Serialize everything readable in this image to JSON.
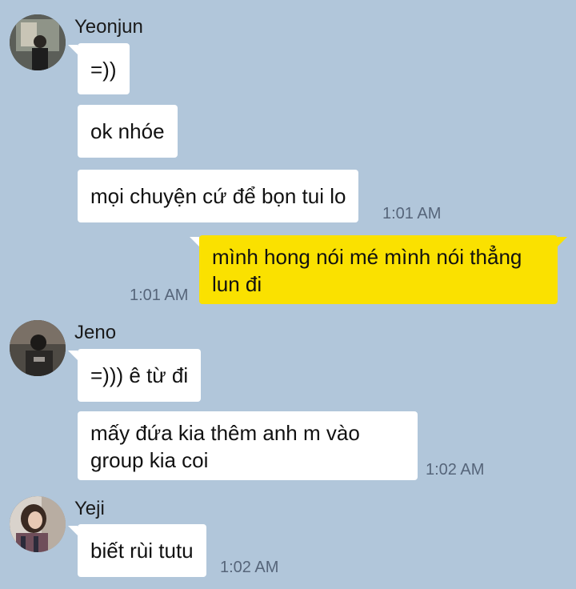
{
  "groups": [
    {
      "sender": "Yeonjun",
      "avatar": "avatar-photo-yeonjun",
      "messages": [
        {
          "text": "=))"
        },
        {
          "text": "ok nhóe"
        },
        {
          "text": "mọi chuyện cứ để bọn tui lo",
          "time": "1:01 AM"
        }
      ]
    },
    {
      "sender": "me",
      "messages": [
        {
          "text": "mình hong nói mé mình nói thẳng\nlun đi",
          "time": "1:01 AM"
        }
      ]
    },
    {
      "sender": "Jeno",
      "avatar": "avatar-photo-jeno",
      "messages": [
        {
          "text": "=))) ê từ đi"
        },
        {
          "text": "mấy đứa kia thêm anh m vào\ngroup kia coi",
          "time": "1:02 AM"
        }
      ]
    },
    {
      "sender": "Yeji",
      "avatar": "avatar-photo-yeji",
      "messages": [
        {
          "text": "biết rùi tutu",
          "time": "1:02 AM"
        }
      ]
    }
  ],
  "colors": {
    "background": "#b1c6da",
    "incoming_bubble": "#ffffff",
    "outgoing_bubble": "#fae100",
    "timestamp": "#56657a"
  }
}
